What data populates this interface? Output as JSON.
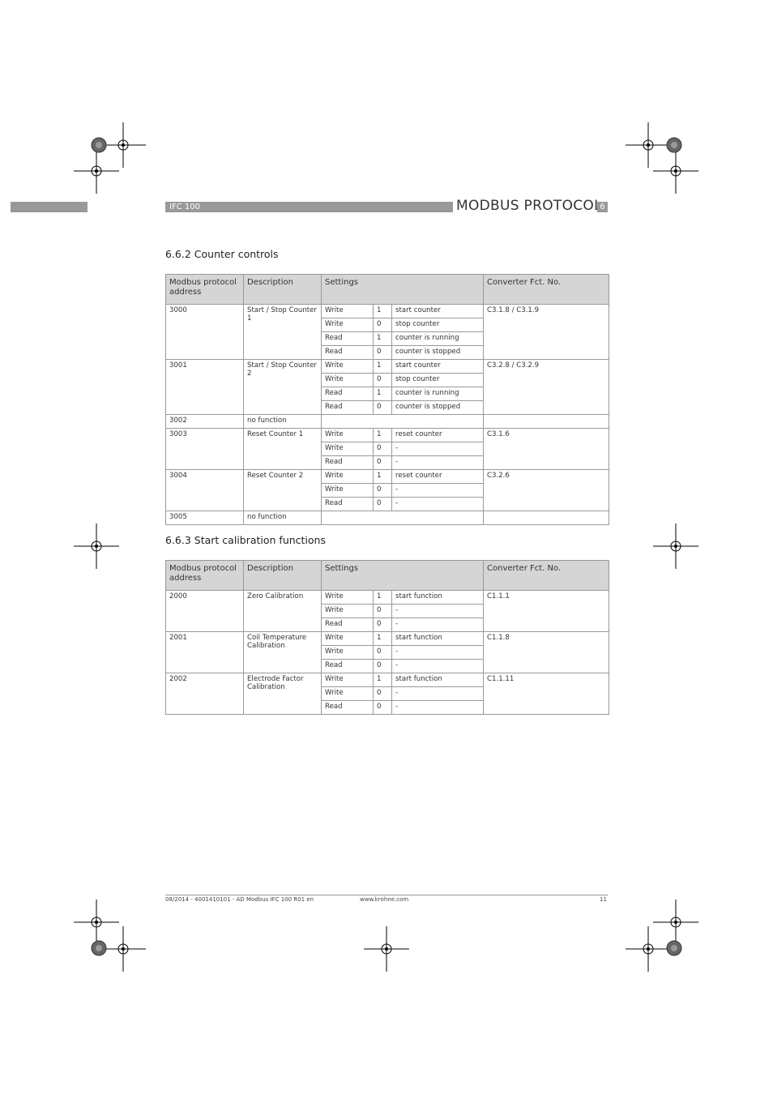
{
  "header": {
    "product": "IFC 100",
    "title": "MODBUS PROTOCOL",
    "chapter": "6"
  },
  "columns": [
    "Modbus protocol address",
    "Description",
    "Settings",
    "Converter Fct. No."
  ],
  "sections": [
    {
      "title": "6.6.2  Counter controls",
      "rows": [
        {
          "address": "3000",
          "description": "Start / Stop Counter 1",
          "converter": "C3.1.8 / C3.1.9",
          "settings": [
            {
              "op": "Write",
              "val": "1",
              "meaning": "start counter"
            },
            {
              "op": "Write",
              "val": "0",
              "meaning": "stop counter"
            },
            {
              "op": "Read",
              "val": "1",
              "meaning": "counter is running"
            },
            {
              "op": "Read",
              "val": "0",
              "meaning": "counter is stopped"
            }
          ]
        },
        {
          "address": "3001",
          "description": "Start / Stop Counter 2",
          "converter": "C3.2.8 / C3.2.9",
          "settings": [
            {
              "op": "Write",
              "val": "1",
              "meaning": "start counter"
            },
            {
              "op": "Write",
              "val": "0",
              "meaning": "stop counter"
            },
            {
              "op": "Read",
              "val": "1",
              "meaning": "counter is running"
            },
            {
              "op": "Read",
              "val": "0",
              "meaning": "counter is stopped"
            }
          ]
        },
        {
          "address": "3002",
          "description": "no function",
          "converter": "",
          "settings": []
        },
        {
          "address": "3003",
          "description": "Reset Counter 1",
          "converter": "C3.1.6",
          "settings": [
            {
              "op": "Write",
              "val": "1",
              "meaning": "reset counter"
            },
            {
              "op": "Write",
              "val": "0",
              "meaning": "-"
            },
            {
              "op": "Read",
              "val": "0",
              "meaning": "-"
            }
          ]
        },
        {
          "address": "3004",
          "description": "Reset Counter 2",
          "converter": "C3.2.6",
          "settings": [
            {
              "op": "Write",
              "val": "1",
              "meaning": "reset counter"
            },
            {
              "op": "Write",
              "val": "0",
              "meaning": "-"
            },
            {
              "op": "Read",
              "val": "0",
              "meaning": "-"
            }
          ]
        },
        {
          "address": "3005",
          "description": "no function",
          "converter": "",
          "settings": []
        }
      ]
    },
    {
      "title": "6.6.3  Start calibration functions",
      "rows": [
        {
          "address": "2000",
          "description": "Zero Calibration",
          "converter": "C1.1.1",
          "settings": [
            {
              "op": "Write",
              "val": "1",
              "meaning": "start function"
            },
            {
              "op": "Write",
              "val": "0",
              "meaning": "-"
            },
            {
              "op": "Read",
              "val": "0",
              "meaning": "-"
            }
          ]
        },
        {
          "address": "2001",
          "description": "Coil Temperature Calibration",
          "converter": "C1.1.8",
          "settings": [
            {
              "op": "Write",
              "val": "1",
              "meaning": "start function"
            },
            {
              "op": "Write",
              "val": "0",
              "meaning": "-"
            },
            {
              "op": "Read",
              "val": "0",
              "meaning": "-"
            }
          ]
        },
        {
          "address": "2002",
          "description": "Electrode Factor Calibration",
          "converter": "C1.1.11",
          "settings": [
            {
              "op": "Write",
              "val": "1",
              "meaning": "start function"
            },
            {
              "op": "Write",
              "val": "0",
              "meaning": "-"
            },
            {
              "op": "Read",
              "val": "0",
              "meaning": "-"
            }
          ]
        }
      ]
    }
  ],
  "footer": {
    "doc": "08/2014 - 4001410101 - AD Modbus IFC 100 R01 en",
    "url": "www.krohne.com",
    "page": "11"
  }
}
